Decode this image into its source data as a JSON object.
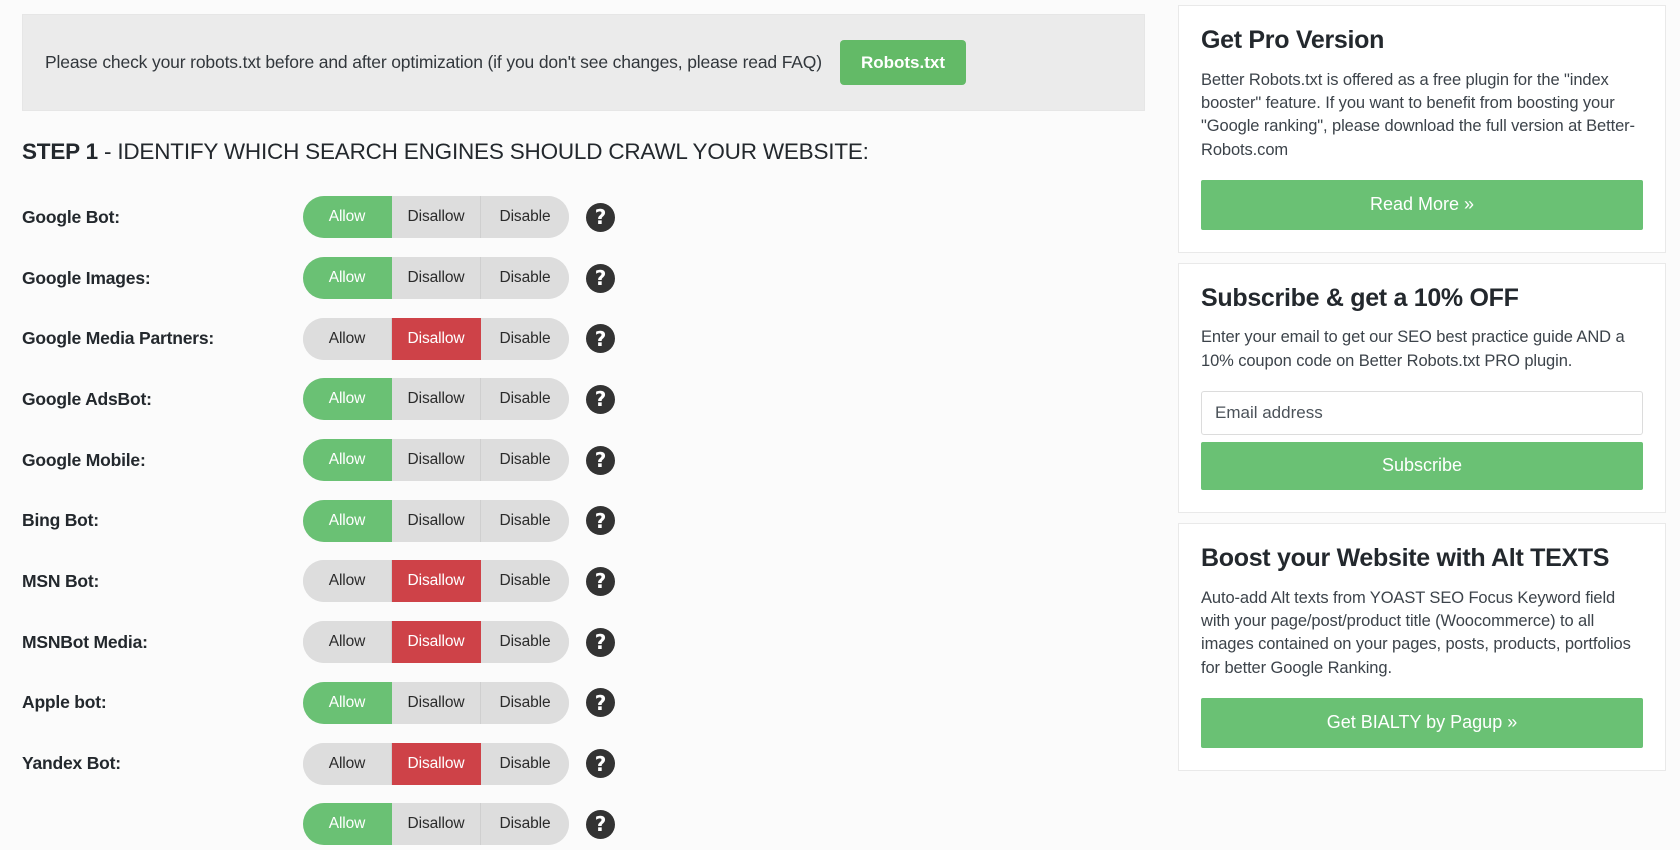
{
  "notice": {
    "text": "Please check your robots.txt before and after optimization (if you don't see changes, please read FAQ)",
    "button_label": "Robots.txt"
  },
  "step": {
    "prefix": "STEP 1",
    "rest": " - IDENTIFY WHICH SEARCH ENGINES SHOULD CRAWL YOUR WEBSITE:"
  },
  "options": {
    "allow": "Allow",
    "disallow": "Disallow",
    "disable": "Disable"
  },
  "help_icon": "?",
  "bots": [
    {
      "label": "Google Bot:",
      "state": "allow"
    },
    {
      "label": "Google Images:",
      "state": "allow"
    },
    {
      "label": "Google Media Partners:",
      "state": "disallow"
    },
    {
      "label": "Google AdsBot:",
      "state": "allow"
    },
    {
      "label": "Google Mobile:",
      "state": "allow"
    },
    {
      "label": "Bing Bot:",
      "state": "allow"
    },
    {
      "label": "MSN Bot:",
      "state": "disallow"
    },
    {
      "label": "MSNBot Media:",
      "state": "disallow"
    },
    {
      "label": "Apple bot:",
      "state": "allow"
    },
    {
      "label": "Yandex Bot:",
      "state": "disallow"
    },
    {
      "label": "",
      "state": "allow"
    }
  ],
  "sidebar": {
    "cards": [
      {
        "title": "Get Pro Version",
        "body": "Better Robots.txt is offered as a free plugin for the \"index booster\" feature. If you want to benefit from boosting your \"Google ranking\", please download the full version at Better-Robots.com",
        "cta": "Read More »"
      },
      {
        "title": "Subscribe & get a 10% OFF",
        "body": "Enter your email to get our SEO best practice guide AND a 10% coupon code on Better Robots.txt PRO plugin.",
        "input_placeholder": "Email address",
        "input_value": "",
        "cta": "Subscribe"
      },
      {
        "title": "Boost your Website with Alt TEXTS",
        "body": "Auto-add Alt texts from YOAST SEO Focus Keyword field with your page/post/product title (Woocommerce) to all images contained on your pages, posts, products, portfolios for better Google Ranking.",
        "cta": "Get BIALTY by Pagup »"
      }
    ]
  },
  "colors": {
    "green": "#6ac174",
    "red": "#ce4248",
    "inactive": "#dddddd",
    "notice_bg": "#ebebeb",
    "page_bg": "#fbfbfb"
  }
}
